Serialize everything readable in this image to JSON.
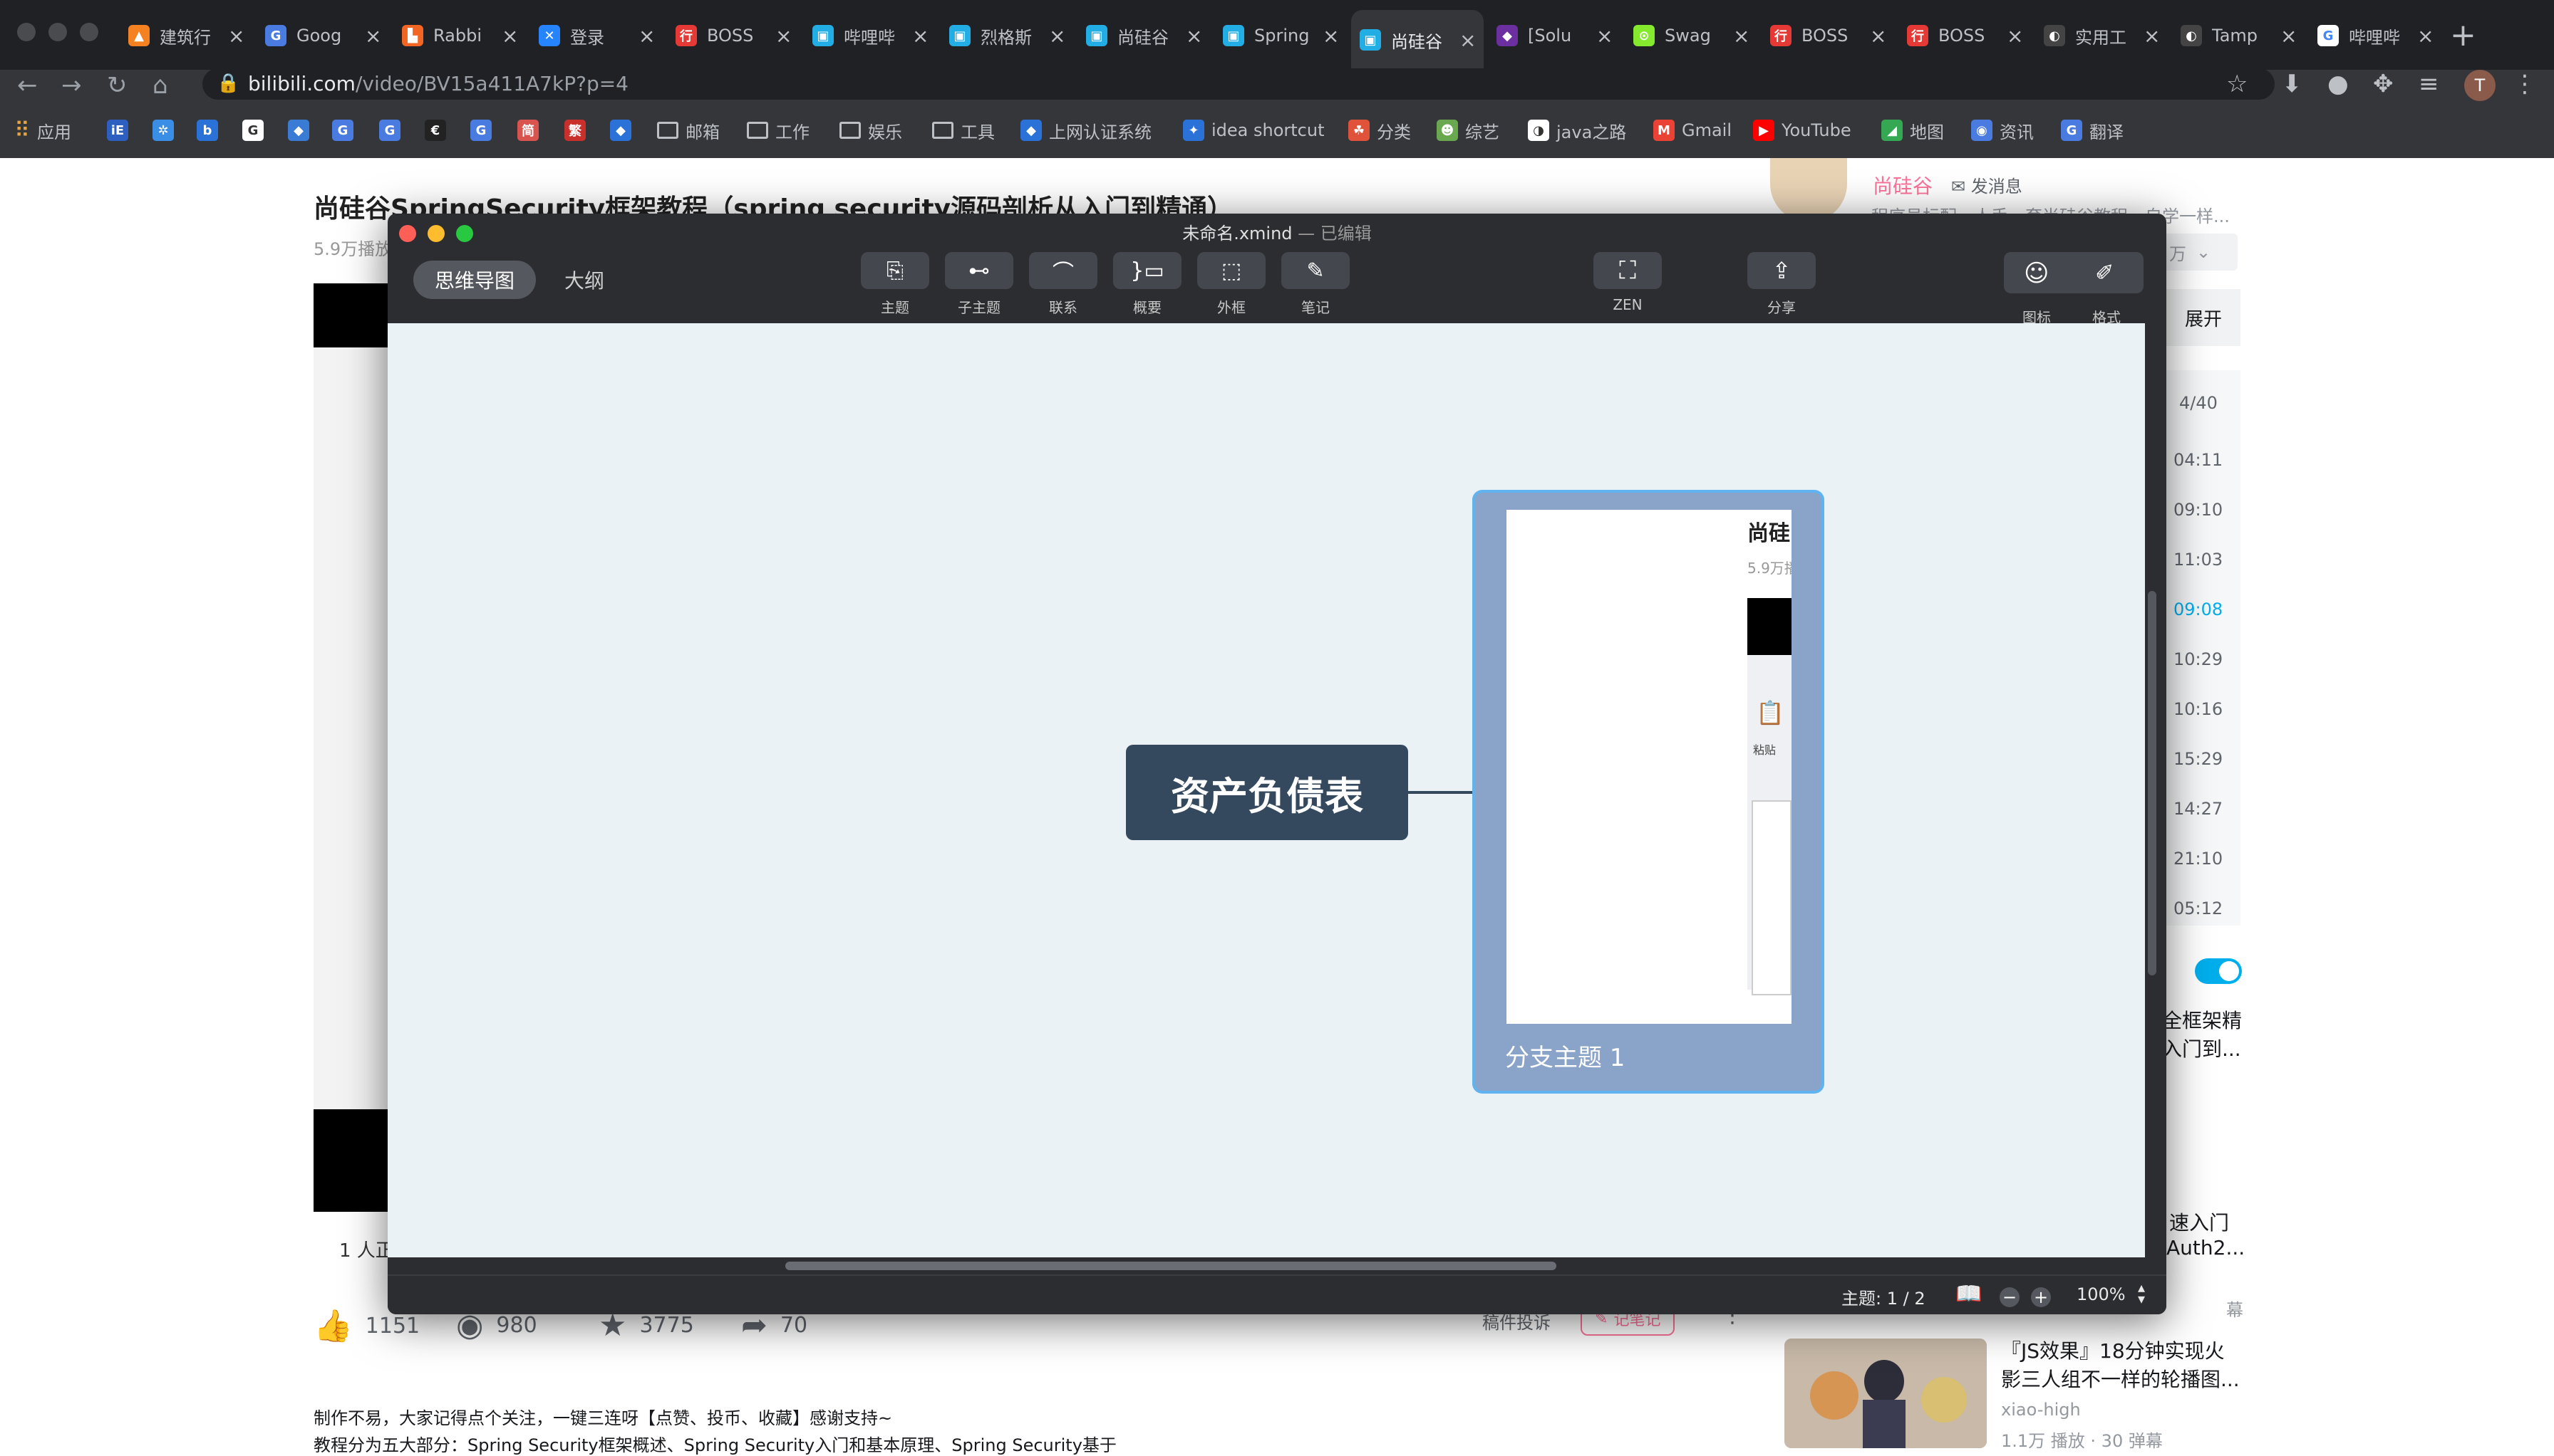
{
  "browser": {
    "tabs": [
      {
        "title": "建筑行",
        "icon_color": "#f58220",
        "glyph": "▲"
      },
      {
        "title": "Goog",
        "icon_color": "#4a7be0",
        "glyph": "G"
      },
      {
        "title": "Rabbi",
        "icon_color": "#f26522",
        "glyph": "▙"
      },
      {
        "title": "登录",
        "icon_color": "#2684ff",
        "glyph": "✕"
      },
      {
        "title": "BOSS",
        "icon_color": "#e53935",
        "glyph": "行"
      },
      {
        "title": "哔哩哔",
        "icon_color": "#23ade5",
        "glyph": "▣"
      },
      {
        "title": "烈格斯",
        "icon_color": "#23ade5",
        "glyph": "▣"
      },
      {
        "title": "尚硅谷",
        "icon_color": "#23ade5",
        "glyph": "▣"
      },
      {
        "title": "Spring",
        "icon_color": "#23ade5",
        "glyph": "▣"
      },
      {
        "title": "尚硅谷",
        "icon_color": "#23ade5",
        "glyph": "▣"
      },
      {
        "title": "[Solu",
        "icon_color": "#6b2fa0",
        "glyph": "◆"
      },
      {
        "title": "Swag",
        "icon_color": "#85ea2d",
        "glyph": "⊙"
      },
      {
        "title": "BOSS",
        "icon_color": "#e53935",
        "glyph": "行"
      },
      {
        "title": "BOSS",
        "icon_color": "#e53935",
        "glyph": "行"
      },
      {
        "title": "实用工",
        "icon_color": "#444444",
        "glyph": "◐"
      },
      {
        "title": "Tamp",
        "icon_color": "#444444",
        "glyph": "◐"
      },
      {
        "title": "哔哩哔",
        "icon_color": "#ffffff",
        "glyph": "G"
      }
    ],
    "active_tab_index": 9,
    "url_host": "bilibili.com",
    "url_path": "/video/BV15a411A7kP?p=4",
    "avatar_letter": "T",
    "bookmarks": [
      {
        "label": "应用",
        "type": "apps"
      },
      {
        "label": "",
        "type": "icon",
        "color": "#2c5fbf",
        "glyph": "iE"
      },
      {
        "label": "",
        "type": "icon",
        "color": "#3b8ee6",
        "glyph": "✲"
      },
      {
        "label": "",
        "type": "icon",
        "color": "#2a72d8",
        "glyph": "b"
      },
      {
        "label": "",
        "type": "icon",
        "color": "#ffffff",
        "glyph": "G"
      },
      {
        "label": "",
        "type": "icon",
        "color": "#3a7bd5",
        "glyph": "◆"
      },
      {
        "label": "",
        "type": "icon",
        "color": "#4a7be0",
        "glyph": "G"
      },
      {
        "label": "",
        "type": "icon",
        "color": "#4a7be0",
        "glyph": "G"
      },
      {
        "label": "",
        "type": "icon",
        "color": "#222222",
        "glyph": "€"
      },
      {
        "label": "",
        "type": "icon",
        "color": "#4a7be0",
        "glyph": "G"
      },
      {
        "label": "",
        "type": "icon",
        "color": "#d9534f",
        "glyph": "简"
      },
      {
        "label": "",
        "type": "icon",
        "color": "#c9302c",
        "glyph": "繁"
      },
      {
        "label": "",
        "type": "icon",
        "color": "#2a72d8",
        "glyph": "◆"
      },
      {
        "label": "邮箱",
        "type": "folder"
      },
      {
        "label": "工作",
        "type": "folder"
      },
      {
        "label": "娱乐",
        "type": "folder"
      },
      {
        "label": "工具",
        "type": "folder"
      },
      {
        "label": "上网认证系统",
        "type": "icon",
        "color": "#2a72d8",
        "glyph": "◆"
      },
      {
        "label": "idea shortcut",
        "type": "icon",
        "color": "#2a72d8",
        "glyph": "✦"
      },
      {
        "label": "分类",
        "type": "icon",
        "color": "#e0533a",
        "glyph": "☘"
      },
      {
        "label": "综艺",
        "type": "icon",
        "color": "#6aa84f",
        "glyph": "☻"
      },
      {
        "label": "java之路",
        "type": "icon",
        "color": "#ffffff",
        "glyph": "◑"
      },
      {
        "label": "Gmail",
        "type": "icon",
        "color": "#ea4335",
        "glyph": "M"
      },
      {
        "label": "YouTube",
        "type": "icon",
        "color": "#ff0000",
        "glyph": "▶"
      },
      {
        "label": "地图",
        "type": "icon",
        "color": "#34a853",
        "glyph": "◢"
      },
      {
        "label": "资讯",
        "type": "icon",
        "color": "#4a7be0",
        "glyph": "◉"
      },
      {
        "label": "翻译",
        "type": "icon",
        "color": "#4a7be0",
        "glyph": "G"
      }
    ]
  },
  "bilibili": {
    "video_title": "尚硅谷SpringSecurity框架教程（spring security源码剖析从入门到精通）",
    "video_meta": "5.9万播放",
    "viewers": "1 人正",
    "likes": "1151",
    "coins": "980",
    "favorites": "3775",
    "shares": "70",
    "report_label": "稿件投诉",
    "note_label": "记笔记",
    "description_line1": "制作不易，大家记得点个关注，一键三连呀【点赞、投币、收藏】感谢支持~",
    "description_line2": "教程分为五大部分：Spring Security框架概述、Spring Security入门和基本原理、Spring Security基于",
    "up_name": "尚硅谷",
    "message_label": "发消息",
    "up_desc": "程序员标配，人手一套尚硅谷教程，自学一样...",
    "follow_label": "万",
    "expand_label": "展开",
    "episode_progress": "4/40",
    "episode_times": [
      "04:11",
      "09:10",
      "11:03",
      "09:08",
      "10:29",
      "10:16",
      "15:29",
      "14:27",
      "21:10",
      "05:12"
    ],
    "rec1_line1": "全框架精",
    "rec1_line2": "入门到...",
    "rec2_line1": "速入门",
    "rec2_line2": "Auth2...",
    "rec2_suffix": "幕",
    "rec3_title": "『JS效果』18分钟实现火影三人组不一样的轮播图...",
    "rec3_author": "xiao-high",
    "rec3_stats": "1.1万 播放 · 30 弹幕"
  },
  "xmind": {
    "filename": "未命名.xmind",
    "edited": " — 已编辑",
    "mode_mindmap": "思维导图",
    "mode_outline": "大纲",
    "tools": [
      {
        "label": "主题",
        "icon": "topic-icon",
        "glyph": "⎘"
      },
      {
        "label": "子主题",
        "icon": "subtopic-icon",
        "glyph": "⊷"
      },
      {
        "label": "联系",
        "icon": "relationship-icon",
        "glyph": "⌒"
      },
      {
        "label": "概要",
        "icon": "summary-icon",
        "glyph": "}▭"
      },
      {
        "label": "外框",
        "icon": "boundary-icon",
        "glyph": "⬚"
      },
      {
        "label": "笔记",
        "icon": "note-icon",
        "glyph": "✎"
      }
    ],
    "zen_label": "ZEN",
    "share_label": "分享",
    "icon_panel_label": "图标",
    "format_panel_label": "格式",
    "central_topic": "资产负债表",
    "branch_topic": "分支主题 1",
    "image_text_title": "尚硅",
    "image_text_meta": "5.9万播",
    "image_text_paste": "粘贴",
    "topic_count": "主题: 1 / 2",
    "zoom": "100%"
  }
}
